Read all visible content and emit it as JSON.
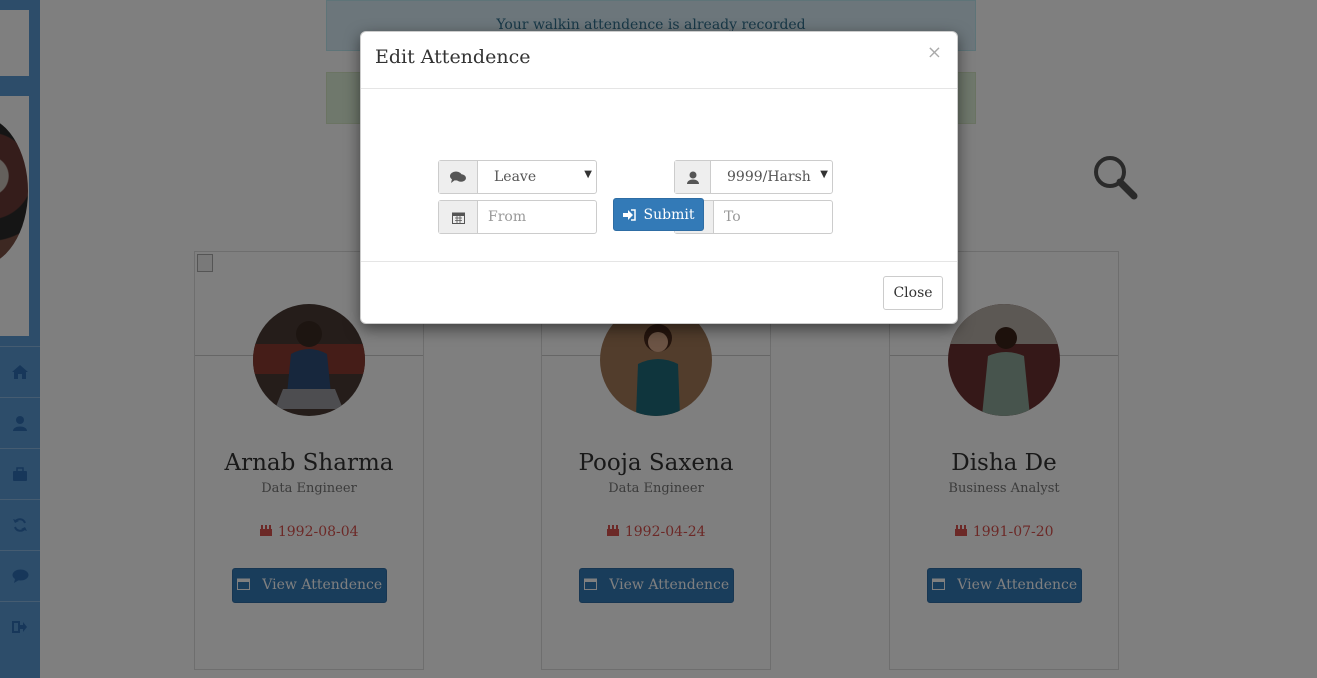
{
  "alerts": {
    "info": "Your walkin attendence is already recorded"
  },
  "sidebar": {
    "items": [
      {
        "icon": "home-icon"
      },
      {
        "icon": "user-icon"
      },
      {
        "icon": "briefcase-icon"
      },
      {
        "icon": "refresh-icon"
      },
      {
        "icon": "comment-icon"
      },
      {
        "icon": "sign-out-icon"
      }
    ]
  },
  "employees": [
    {
      "name": "Arnab Sharma",
      "role": "Data Engineer",
      "dob": "1992-08-04",
      "button": "View Attendence"
    },
    {
      "name": "Pooja Saxena",
      "role": "Data Engineer",
      "dob": "1992-04-24",
      "button": "View Attendence"
    },
    {
      "name": "Disha De",
      "role": "Business Analyst",
      "dob": "1991-07-20",
      "button": "View Attendence"
    }
  ],
  "modal": {
    "title": "Edit Attendence",
    "close_x": "×",
    "type_select": "Leave",
    "employee_select": "9999/Harsh",
    "from_placeholder": "From",
    "to_placeholder": "To",
    "submit_label": "Submit",
    "close_label": "Close"
  },
  "colors": {
    "primary": "#337ab7",
    "sidebar": "#5b9bd5",
    "dob": "#d9534f"
  }
}
